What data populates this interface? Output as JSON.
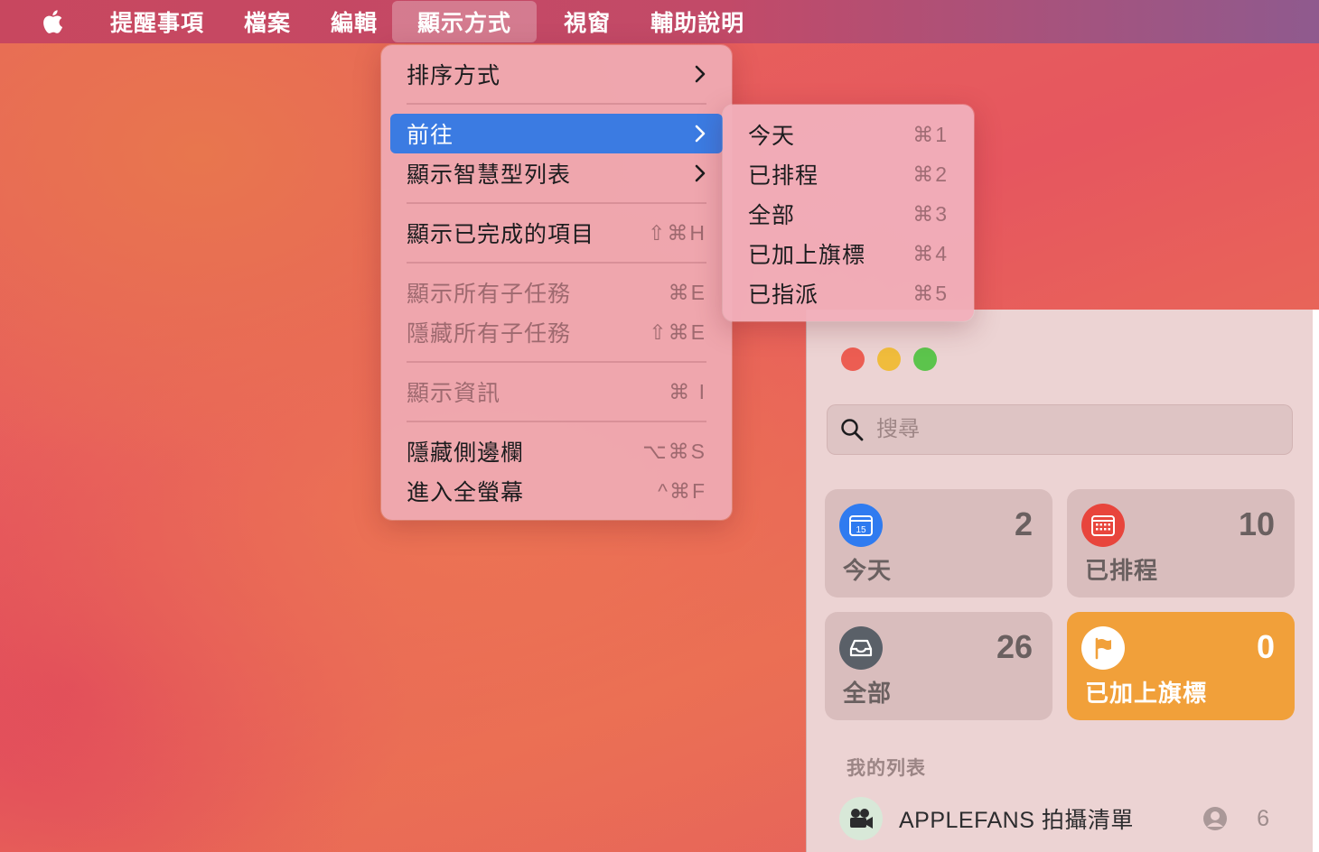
{
  "menubar": {
    "apple": "apple-icon",
    "items": [
      "提醒事項",
      "檔案",
      "編輯",
      "顯示方式",
      "視窗",
      "輔助說明"
    ],
    "active": "顯示方式"
  },
  "menu": {
    "items": [
      {
        "label": "排序方式",
        "submenu": true
      },
      {
        "label": "前往",
        "submenu": true,
        "highlighted": true
      },
      {
        "label": "顯示智慧型列表",
        "submenu": true
      },
      {
        "label": "顯示已完成的項目",
        "shortcut": "⇧⌘H"
      },
      {
        "label": "顯示所有子任務",
        "shortcut": "⌘E",
        "disabled": true
      },
      {
        "label": "隱藏所有子任務",
        "shortcut": "⇧⌘E",
        "disabled": true
      },
      {
        "label": "顯示資訊",
        "shortcut": "⌘ I",
        "disabled": true
      },
      {
        "label": "隱藏側邊欄",
        "shortcut": "⌥⌘S"
      },
      {
        "label": "進入全螢幕",
        "shortcut": "^⌘F"
      }
    ]
  },
  "submenu": {
    "items": [
      {
        "label": "今天",
        "shortcut": "⌘1"
      },
      {
        "label": "已排程",
        "shortcut": "⌘2"
      },
      {
        "label": "全部",
        "shortcut": "⌘3"
      },
      {
        "label": "已加上旗標",
        "shortcut": "⌘4"
      },
      {
        "label": "已指派",
        "shortcut": "⌘5"
      }
    ]
  },
  "window": {
    "search_placeholder": "搜尋",
    "tiles": [
      {
        "label": "今天",
        "count": "2",
        "icon": "calendar-today-icon",
        "icon_text": "15",
        "color": "#2f7bf0"
      },
      {
        "label": "已排程",
        "count": "10",
        "icon": "calendar-grid-icon",
        "color": "#e8453c"
      },
      {
        "label": "全部",
        "count": "26",
        "icon": "tray-icon",
        "color": "#5a6068"
      },
      {
        "label": "已加上旗標",
        "count": "0",
        "icon": "flag-icon",
        "color": "#f1a03a"
      }
    ],
    "section_title": "我的列表",
    "lists": [
      {
        "name": "APPLEFANS 拍攝清單",
        "count": "6",
        "icon": "camera-icon",
        "shared_icon": "person-icon"
      }
    ]
  },
  "colors": {
    "highlight": "#3b7be2",
    "close": "#ec5d52",
    "minimize": "#f0bc3c",
    "zoom": "#5cc44c"
  }
}
